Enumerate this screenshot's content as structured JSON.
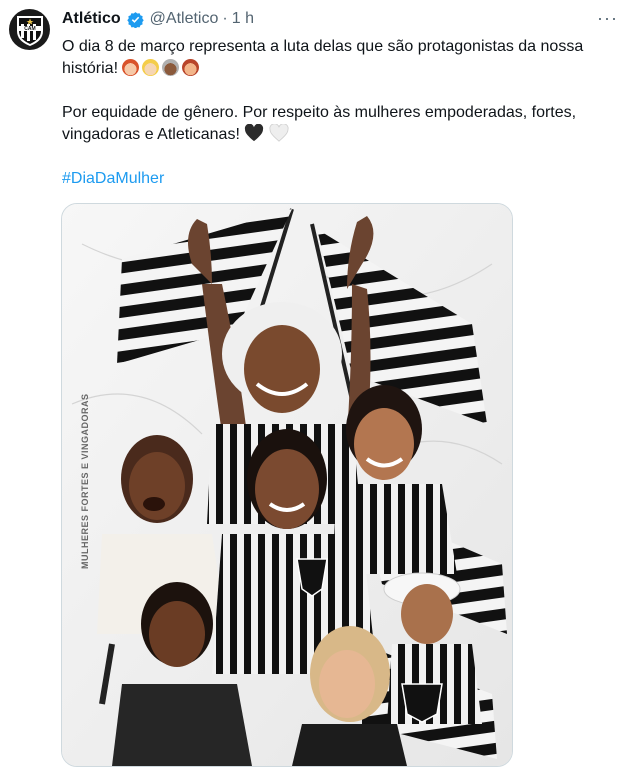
{
  "author": {
    "name": "Atlético",
    "handle": "@Atletico",
    "separator": "·",
    "time": "1 h",
    "avatar_icon": "atletico-crest-icon",
    "verified_icon": "verified-badge-icon"
  },
  "menu": {
    "icon": "more-options-icon",
    "glyph": "···"
  },
  "text": {
    "line1": "O dia 8 de março representa a luta delas que são protagonistas da nossa história!",
    "line2": "Por equidade de gênero. Por respeito às mulheres empoderadas, fortes, vingadoras e Atleticanas!",
    "hashtag": "#DiaDaMulher"
  },
  "emojis": [
    "woman-red-hair-emoji",
    "woman-blond-emoji",
    "old-woman-emoji",
    "woman-curly-hair-emoji"
  ],
  "hearts": [
    "black-heart-emoji",
    "white-heart-emoji"
  ],
  "media": {
    "vertical_text": "MULHERES FORTES E VINGADORAS",
    "crest_text": "CAM"
  },
  "colors": {
    "accent": "#1d9bf0",
    "text": "#0f1419",
    "muted": "#536471",
    "border": "#cfd9de"
  }
}
